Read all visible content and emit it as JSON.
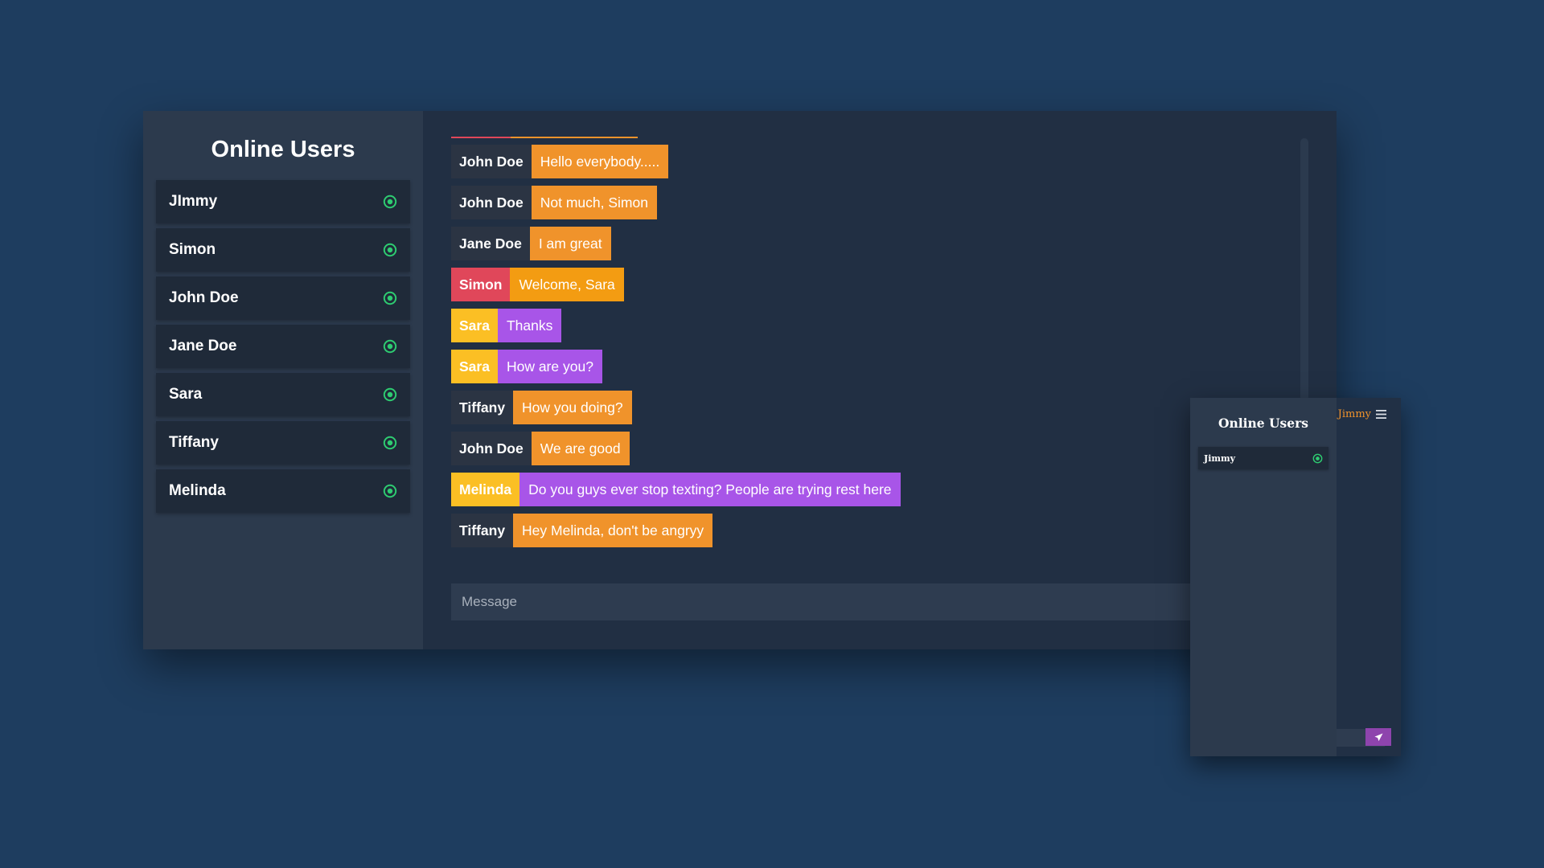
{
  "sidebar": {
    "title": "Online Users",
    "users": [
      {
        "name": "JImmy"
      },
      {
        "name": "Simon"
      },
      {
        "name": "John Doe"
      },
      {
        "name": "Jane Doe"
      },
      {
        "name": "Sara"
      },
      {
        "name": "Tiffany"
      },
      {
        "name": "Melinda"
      }
    ]
  },
  "chat": {
    "messages": [
      {
        "user": "John Doe",
        "text": "Hello everybody.....",
        "name_color": "#2b3443",
        "text_color": "#f0932b"
      },
      {
        "user": "John Doe",
        "text": "Not much, Simon",
        "name_color": "#2b3443",
        "text_color": "#f0932b"
      },
      {
        "user": "Jane Doe",
        "text": "I am great",
        "name_color": "#2b3443",
        "text_color": "#f0932b"
      },
      {
        "user": "Simon",
        "text": "Welcome, Sara",
        "name_color": "#e0475a",
        "text_color": "#f39c12"
      },
      {
        "user": "Sara",
        "text": "Thanks",
        "name_color": "#fbbf24",
        "text_color": "#a855e8"
      },
      {
        "user": "Sara",
        "text": "How are you?",
        "name_color": "#fbbf24",
        "text_color": "#a855e8"
      },
      {
        "user": "Tiffany",
        "text": "How you doing?",
        "name_color": "#2b3443",
        "text_color": "#f0932b"
      },
      {
        "user": "John Doe",
        "text": "We are good",
        "name_color": "#2b3443",
        "text_color": "#f0932b"
      },
      {
        "user": "Melinda",
        "text": "Do you guys ever stop texting? People are trying rest here",
        "name_color": "#fbbf24",
        "text_color": "#a855e8"
      },
      {
        "user": "Tiffany",
        "text": "Hey Melinda, don't be angryy",
        "name_color": "#2b3443",
        "text_color": "#f0932b"
      }
    ],
    "input_placeholder": "Message"
  },
  "mini": {
    "title": "Online Users",
    "users": [
      {
        "name": "Jimmy"
      }
    ],
    "current_user": "Jimmy",
    "menu_icon": "hamburger-icon",
    "send_icon": "send-icon"
  },
  "colors": {
    "background": "#1e3d5f",
    "online": "#2ecc71",
    "accent_orange": "#f0932b",
    "accent_purple": "#a855e8"
  }
}
